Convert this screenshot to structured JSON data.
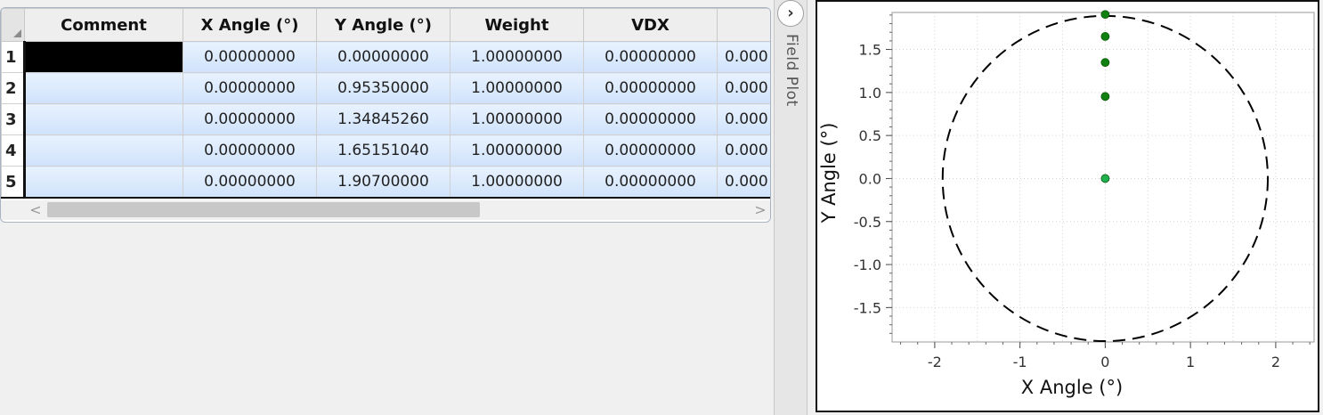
{
  "table": {
    "columns": [
      "Comment",
      "X Angle (°)",
      "Y Angle (°)",
      "Weight",
      "VDX",
      "V"
    ],
    "rows": [
      {
        "num": "1",
        "comment": "",
        "x_angle": "0.00000000",
        "y_angle": "0.00000000",
        "weight": "1.00000000",
        "vdx": "0.00000000",
        "next": "0.000"
      },
      {
        "num": "2",
        "comment": "",
        "x_angle": "0.00000000",
        "y_angle": "0.95350000",
        "weight": "1.00000000",
        "vdx": "0.00000000",
        "next": "0.000"
      },
      {
        "num": "3",
        "comment": "",
        "x_angle": "0.00000000",
        "y_angle": "1.34845260",
        "weight": "1.00000000",
        "vdx": "0.00000000",
        "next": "0.000"
      },
      {
        "num": "4",
        "comment": "",
        "x_angle": "0.00000000",
        "y_angle": "1.65151040",
        "weight": "1.00000000",
        "vdx": "0.00000000",
        "next": "0.000"
      },
      {
        "num": "5",
        "comment": "",
        "x_angle": "0.00000000",
        "y_angle": "1.90700000",
        "weight": "1.00000000",
        "vdx": "0.00000000",
        "next": "0.000"
      }
    ],
    "scroll": {
      "left_arrow": "<",
      "right_arrow": ">"
    }
  },
  "side_panel": {
    "expand_glyph": "›",
    "label": "Field Plot"
  },
  "chart_data": {
    "type": "scatter",
    "xlabel": "X Angle (°)",
    "ylabel": "Y Angle (°)",
    "xlim": [
      -2.5,
      2.45
    ],
    "ylim": [
      -1.9,
      1.93
    ],
    "xticks": [
      -2,
      -1,
      0,
      1,
      2
    ],
    "yticks": [
      -1.5,
      -1.0,
      -0.5,
      0.0,
      0.5,
      1.0,
      1.5
    ],
    "xtick_labels": [
      "-2",
      "-1",
      "0",
      "1",
      "2"
    ],
    "ytick_labels": [
      "-1.5",
      "-1.0",
      "-0.5",
      "0.0",
      "0.5",
      "1.0",
      "1.5"
    ],
    "grid": true,
    "points": [
      {
        "x": 0,
        "y": 0,
        "color": "#20b050"
      },
      {
        "x": 0,
        "y": 0.9535,
        "color": "#108010"
      },
      {
        "x": 0,
        "y": 1.34845,
        "color": "#108010"
      },
      {
        "x": 0,
        "y": 1.65151,
        "color": "#108010"
      },
      {
        "x": 0,
        "y": 1.907,
        "color": "#108010"
      }
    ],
    "boundary_circle": {
      "radius": 1.907,
      "style": "dashed",
      "color": "#000000"
    }
  }
}
